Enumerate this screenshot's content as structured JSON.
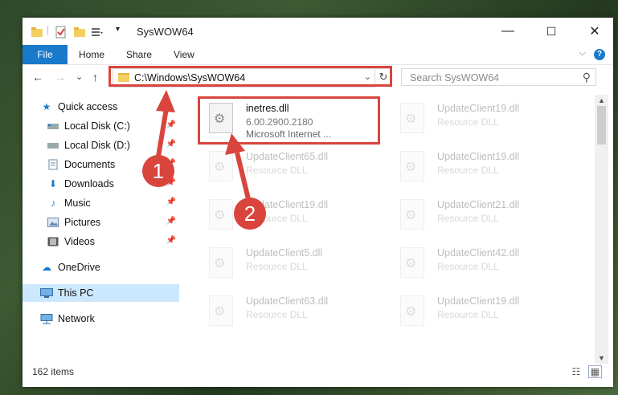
{
  "window": {
    "title": "SysWOW64",
    "controls": {
      "minimize": "—",
      "maximize": "☐",
      "close": "✕"
    }
  },
  "ribbon": {
    "tabs": [
      "File",
      "Home",
      "Share",
      "View"
    ],
    "collapse": "⌵",
    "help": "?"
  },
  "nav": {
    "back": "←",
    "forward": "→",
    "recent": "⌄",
    "up": "↑",
    "address": "C:\\Windows\\SysWOW64",
    "refresh": "↻",
    "search_placeholder": "Search SysWOW64"
  },
  "sidebar": {
    "items": [
      {
        "label": "Quick access",
        "icon": "star-icon"
      },
      {
        "label": "Local Disk (C:)",
        "icon": "drive-icon"
      },
      {
        "label": "Local Disk (D:)",
        "icon": "drive-icon"
      },
      {
        "label": "Documents",
        "icon": "document-icon"
      },
      {
        "label": "Downloads",
        "icon": "download-icon"
      },
      {
        "label": "Music",
        "icon": "music-icon"
      },
      {
        "label": "Pictures",
        "icon": "picture-icon"
      },
      {
        "label": "Videos",
        "icon": "video-icon"
      },
      {
        "label": "OneDrive",
        "icon": "cloud-icon"
      },
      {
        "label": "This PC",
        "icon": "computer-icon"
      },
      {
        "label": "Network",
        "icon": "network-icon"
      }
    ]
  },
  "files": [
    {
      "name": "inetres.dll",
      "d1": "6.00.2900.2180",
      "d2": "Microsoft Internet ..."
    },
    {
      "name": "UpdateClient19.dll",
      "d1": "Resource DLL"
    },
    {
      "name": "UpdateClient65.dll",
      "d1": "Resource DLL"
    },
    {
      "name": "UpdateClient19.dll",
      "d1": "Resource DLL"
    },
    {
      "name": "UpdateClient19.dll",
      "d1": "Resource DLL"
    },
    {
      "name": "UpdateClient21.dll",
      "d1": "Resource DLL"
    },
    {
      "name": "UpdateClient5.dll",
      "d1": "Resource DLL"
    },
    {
      "name": "UpdateClient42.dll",
      "d1": "Resource DLL"
    },
    {
      "name": "UpdateClient63.dll",
      "d1": "Resource DLL"
    },
    {
      "name": "UpdateClient19.dll",
      "d1": "Resource DLL"
    }
  ],
  "status": {
    "count": "162 items"
  },
  "callouts": [
    "1",
    "2"
  ],
  "colors": {
    "accent": "#1979ca",
    "highlight": "#d9443d",
    "selection": "#cce8ff"
  }
}
